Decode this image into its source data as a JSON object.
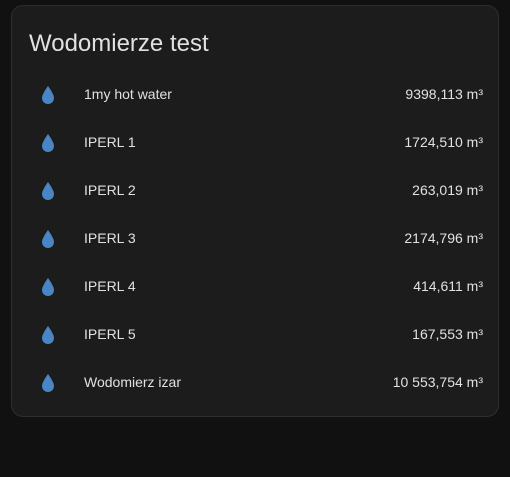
{
  "card": {
    "title": "Wodomierze test"
  },
  "entities": [
    {
      "icon": "water-drop-icon",
      "name": "1my hot water",
      "value": "9398,113 m³"
    },
    {
      "icon": "water-drop-icon",
      "name": "IPERL 1",
      "value": "1724,510 m³"
    },
    {
      "icon": "water-drop-icon",
      "name": "IPERL 2",
      "value": "263,019 m³"
    },
    {
      "icon": "water-drop-icon",
      "name": "IPERL 3",
      "value": "2174,796 m³"
    },
    {
      "icon": "water-drop-icon",
      "name": "IPERL 4",
      "value": "414,611 m³"
    },
    {
      "icon": "water-drop-icon",
      "name": "IPERL 5",
      "value": "167,553 m³"
    },
    {
      "icon": "water-drop-icon",
      "name": "Wodomierz izar",
      "value": "10 553,754 m³"
    }
  ],
  "colors": {
    "background": "#111111",
    "card": "#1c1c1c",
    "icon": "#4a86c6",
    "text": "#e1e1e1"
  }
}
